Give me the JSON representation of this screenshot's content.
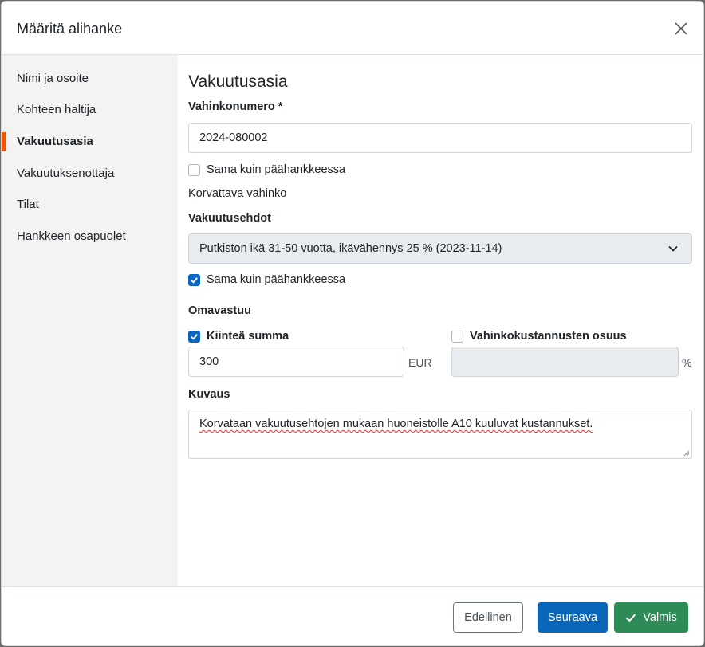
{
  "modal": {
    "title": "Määritä alihanke"
  },
  "sidebar": {
    "items": [
      {
        "label": "Nimi ja osoite"
      },
      {
        "label": "Kohteen haltija"
      },
      {
        "label": "Vakuutusasia"
      },
      {
        "label": "Vakuutuksenottaja"
      },
      {
        "label": "Tilat"
      },
      {
        "label": "Hankkeen osapuolet"
      }
    ],
    "active_index": 2
  },
  "form": {
    "section_title": "Vakuutusasia",
    "claim_number_label": "Vahinkonumero *",
    "claim_number_value": "2024-080002",
    "same_as_main_1_label": "Sama kuin päähankkeessa",
    "same_as_main_1_checked": false,
    "compensable_damage_text": "Korvattava vahinko",
    "terms_label": "Vakuutusehdot",
    "terms_value": "Putkiston ikä 31-50 vuotta, ikävähennys 25 % (2023-11-14)",
    "same_as_main_2_label": "Sama kuin päähankkeessa",
    "same_as_main_2_checked": true,
    "deductible_label": "Omavastuu",
    "fixed_amount_label": "Kiinteä summa",
    "fixed_amount_checked": true,
    "fixed_amount_value": "300",
    "fixed_amount_unit": "EUR",
    "share_label": "Vahinkokustannusten osuus",
    "share_checked": false,
    "share_value": "",
    "share_unit": "%",
    "description_label": "Kuvaus",
    "description_value": "Korvataan vakuutusehtojen mukaan huoneistolle A10 kuuluvat kustannukset."
  },
  "footer": {
    "prev_label": "Edellinen",
    "next_label": "Seuraava",
    "done_label": "Valmis"
  },
  "colors": {
    "active_marker": "#e8590c",
    "primary": "#0a66b8",
    "success": "#2e8b57"
  }
}
